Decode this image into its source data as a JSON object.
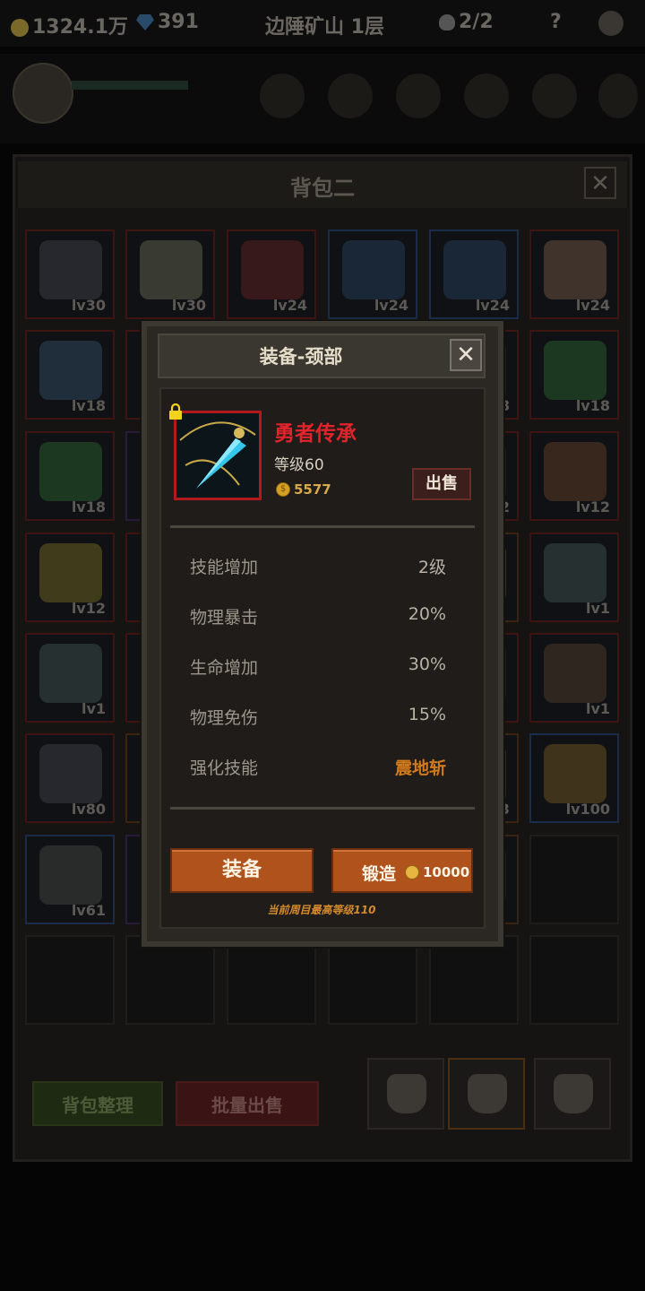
{
  "top_bar": {
    "gold": "1324.1万",
    "gems": "391",
    "location": "边陲矿山 1层",
    "skulls": "2/2",
    "help": "?"
  },
  "backpack": {
    "title": "背包二",
    "close": "✕",
    "rows": [
      [
        {
          "lv": "lv30",
          "q": "red",
          "c": "#3a3d44"
        },
        {
          "lv": "lv30",
          "q": "red",
          "c": "#5d5c48"
        },
        {
          "lv": "lv24",
          "q": "red",
          "c": "#5a2020"
        },
        {
          "lv": "lv24",
          "q": "blue",
          "c": "#253a52"
        },
        {
          "lv": "lv24",
          "q": "blue",
          "c": "#253a52"
        },
        {
          "lv": "lv24",
          "q": "red",
          "c": "#6a5040"
        }
      ],
      [
        {
          "lv": "lv18",
          "q": "red",
          "c": "#30465a"
        },
        {
          "lv": "",
          "q": "red",
          "c": "#2a2a2a"
        },
        {
          "lv": "",
          "q": "red",
          "c": "#2a2a2a"
        },
        {
          "lv": "",
          "q": "red",
          "c": "#2a2a2a"
        },
        {
          "lv": "8",
          "q": "red",
          "c": "#2a2a2a"
        },
        {
          "lv": "lv18",
          "q": "red",
          "c": "#285a2a"
        }
      ],
      [
        {
          "lv": "lv18",
          "q": "red",
          "c": "#285a2a"
        },
        {
          "lv": "",
          "q": "purple",
          "c": "#2a2a2a"
        },
        {
          "lv": "",
          "q": "red",
          "c": "#2a2a2a"
        },
        {
          "lv": "",
          "q": "red",
          "c": "#2a2a2a"
        },
        {
          "lv": "2",
          "q": "red",
          "c": "#2a2a2a"
        },
        {
          "lv": "lv12",
          "q": "red",
          "c": "#5a3a22"
        }
      ],
      [
        {
          "lv": "lv12",
          "q": "red",
          "c": "#6a6020"
        },
        {
          "lv": "",
          "q": "red",
          "c": "#2a2a2a"
        },
        {
          "lv": "",
          "q": "red",
          "c": "#2a2a2a"
        },
        {
          "lv": "",
          "q": "red",
          "c": "#2a2a2a"
        },
        {
          "lv": "",
          "q": "orange",
          "c": "#5a4a20"
        },
        {
          "lv": "lv1",
          "q": "red",
          "c": "#3a4a48"
        }
      ],
      [
        {
          "lv": "lv1",
          "q": "red",
          "c": "#3a4a48"
        },
        {
          "lv": "",
          "q": "red",
          "c": "#2a2a2a"
        },
        {
          "lv": "",
          "q": "red",
          "c": "#2a2a2a"
        },
        {
          "lv": "",
          "q": "red",
          "c": "#2a2a2a"
        },
        {
          "lv": "",
          "q": "red",
          "c": "#2a2a2a"
        },
        {
          "lv": "lv1",
          "q": "red",
          "c": "#4a3a28"
        }
      ],
      [
        {
          "lv": "lv80",
          "q": "red",
          "c": "#3a3d44"
        },
        {
          "lv": "",
          "q": "orange",
          "c": "#4a3a20"
        },
        {
          "lv": "",
          "q": "red",
          "c": "#2a2a2a"
        },
        {
          "lv": "",
          "q": "red",
          "c": "#2a2a2a"
        },
        {
          "lv": "3",
          "q": "orange",
          "c": "#4a3a20"
        },
        {
          "lv": "lv100",
          "q": "blue",
          "c": "#6a5020"
        }
      ],
      [
        {
          "lv": "lv61",
          "q": "blue",
          "c": "#40403c"
        },
        {
          "lv": "",
          "q": "purple",
          "c": "#2a2a2a"
        },
        {
          "lv": "",
          "q": "empty",
          "c": ""
        },
        {
          "lv": "",
          "q": "empty",
          "c": ""
        },
        {
          "lv": "",
          "q": "orange",
          "c": "#2a2a2a"
        },
        {
          "lv": "",
          "q": "empty",
          "c": ""
        }
      ],
      [
        {
          "lv": "",
          "q": "empty",
          "c": ""
        },
        {
          "lv": "",
          "q": "empty",
          "c": ""
        },
        {
          "lv": "",
          "q": "empty",
          "c": ""
        },
        {
          "lv": "",
          "q": "empty",
          "c": ""
        },
        {
          "lv": "",
          "q": "empty",
          "c": ""
        },
        {
          "lv": "",
          "q": "empty",
          "c": ""
        }
      ]
    ],
    "sort_label": "背包整理",
    "bulk_sell_label": "批量出售"
  },
  "dialog": {
    "title": "装备-颈部",
    "close": "✕",
    "item_name": "勇者传承",
    "item_level": "等级60",
    "item_price": "5577",
    "sell_label": "出售",
    "stats": [
      {
        "label": "技能增加",
        "value": "2级"
      },
      {
        "label": "物理暴击",
        "value": "20%"
      },
      {
        "label": "生命增加",
        "value": "30%"
      },
      {
        "label": "物理免伤",
        "value": "15%"
      },
      {
        "label": "强化技能",
        "value": "震地斩"
      }
    ],
    "equip_label": "装备",
    "forge_label": "锻造",
    "forge_cost": "10000",
    "max_level_note": "当前周目最高等级110"
  },
  "colors": {
    "accent_red": "#e0242b",
    "button_orange": "#b0521b",
    "skill_orange": "#d07a1c"
  }
}
